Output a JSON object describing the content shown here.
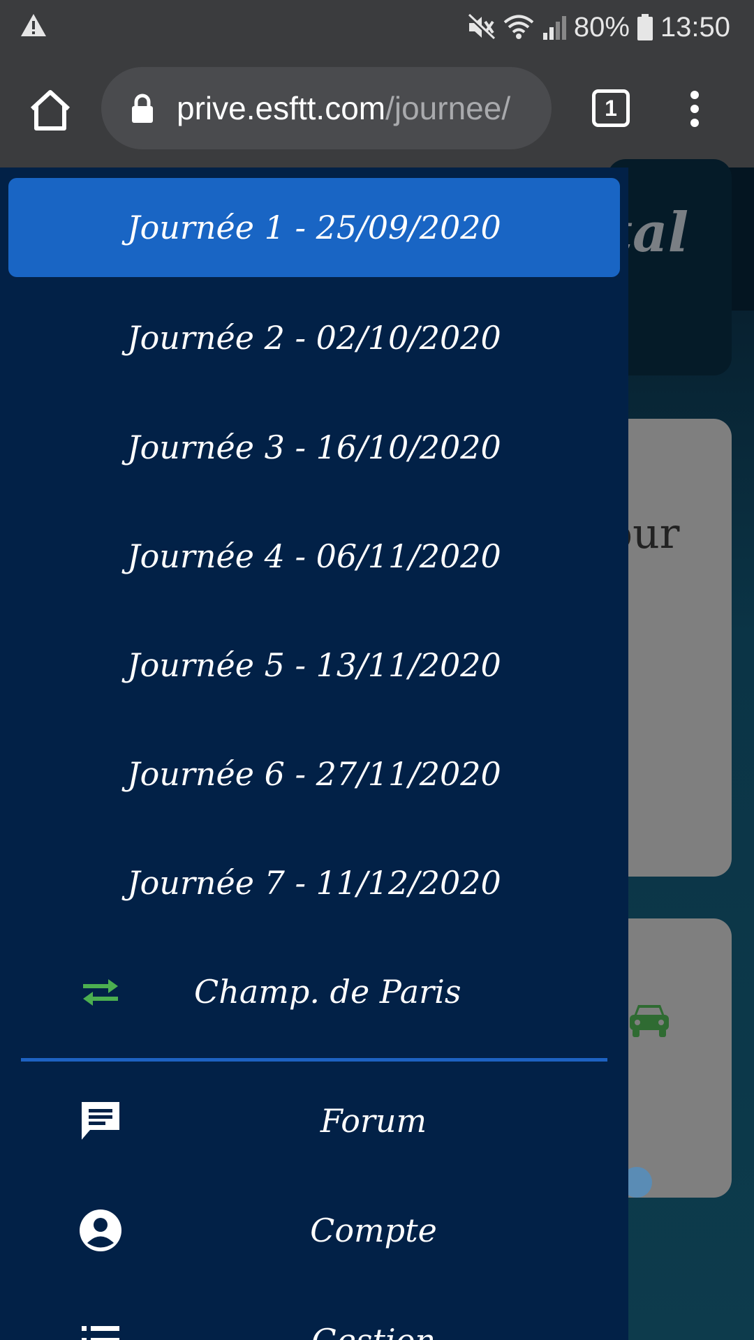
{
  "status_bar": {
    "battery": "80%",
    "time": "13:50"
  },
  "browser": {
    "url_host": "prive.esftt.com",
    "url_path": "/journee/",
    "tab_count": "1"
  },
  "background": {
    "title_fragment": "tal",
    "card_fragment": "our"
  },
  "drawer": {
    "journees": [
      {
        "label": "Journée 1 - 25/09/2020",
        "selected": true
      },
      {
        "label": "Journée 2 - 02/10/2020",
        "selected": false
      },
      {
        "label": "Journée 3 - 16/10/2020",
        "selected": false
      },
      {
        "label": "Journée 4 - 06/11/2020",
        "selected": false
      },
      {
        "label": "Journée 5 - 13/11/2020",
        "selected": false
      },
      {
        "label": "Journée 6 - 27/11/2020",
        "selected": false
      },
      {
        "label": "Journée 7 - 11/12/2020",
        "selected": false
      }
    ],
    "switch_item": {
      "label": "Champ. de Paris",
      "icon": "swap-arrows-icon",
      "icon_color": "#4caf50"
    },
    "menu": [
      {
        "label": "Forum",
        "icon": "chat-icon"
      },
      {
        "label": "Compte",
        "icon": "account-circle-icon"
      },
      {
        "label": "Gestion",
        "icon": "list-icon"
      }
    ]
  },
  "colors": {
    "drawer_bg": "#022147",
    "active_item": "#1965c4",
    "divider": "#1e62c2",
    "browser_bar": "#3b3c3e"
  }
}
